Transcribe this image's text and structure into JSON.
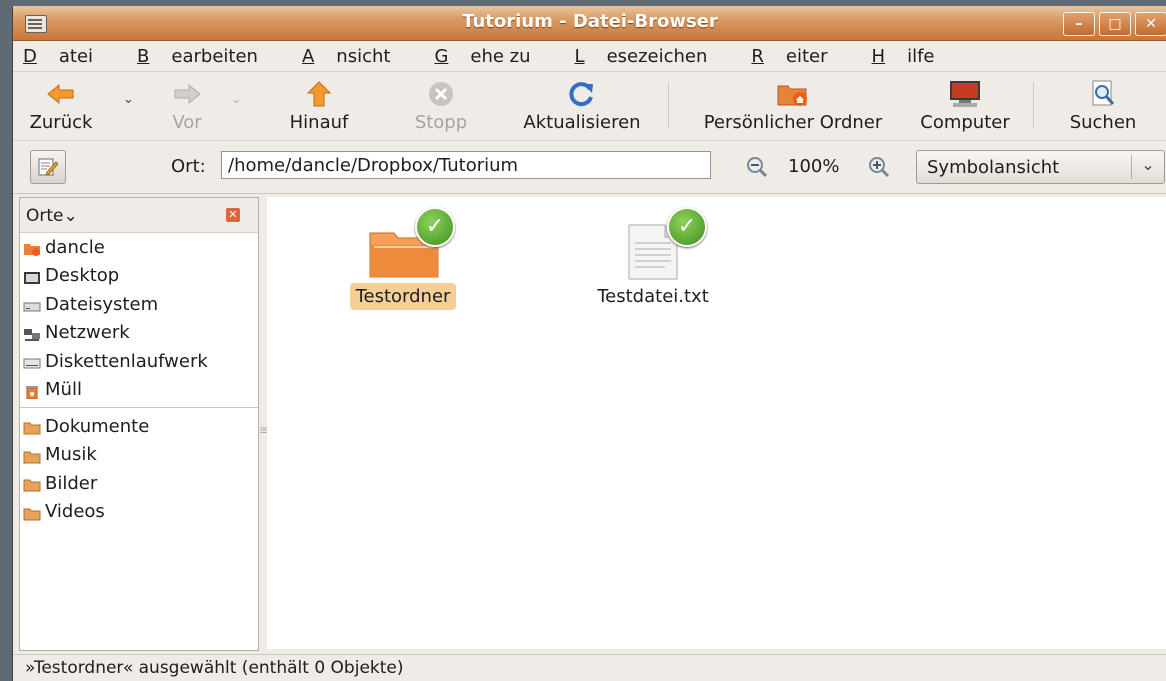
{
  "window": {
    "title": "Tutorium - Datei-Browser"
  },
  "menu": [
    {
      "label": "Datei"
    },
    {
      "label": "Bearbeiten"
    },
    {
      "label": "Ansicht"
    },
    {
      "label": "Gehe zu"
    },
    {
      "label": "Lesezeichen"
    },
    {
      "label": "Reiter"
    },
    {
      "label": "Hilfe"
    }
  ],
  "toolbar": {
    "back": "Zurück",
    "forward": "Vor",
    "up": "Hinauf",
    "stop": "Stopp",
    "reload": "Aktualisieren",
    "home": "Persönlicher Ordner",
    "computer": "Computer",
    "search": "Suchen"
  },
  "location": {
    "label": "Ort:",
    "path": "/home/dancle/Dropbox/Tutorium",
    "zoom": "100%",
    "view": "Symbolansicht"
  },
  "sidebar": {
    "header": "Orte",
    "places": [
      {
        "label": "dancle",
        "icon": "home-folder-icon"
      },
      {
        "label": "Desktop",
        "icon": "desktop-icon"
      },
      {
        "label": "Dateisystem",
        "icon": "filesystem-icon"
      },
      {
        "label": "Netzwerk",
        "icon": "network-icon"
      },
      {
        "label": "Diskettenlaufwerk",
        "icon": "floppy-drive-icon"
      },
      {
        "label": "Müll",
        "icon": "trash-icon"
      }
    ],
    "bookmarks": [
      {
        "label": "Dokumente",
        "icon": "folder-icon"
      },
      {
        "label": "Musik",
        "icon": "folder-icon"
      },
      {
        "label": "Bilder",
        "icon": "folder-icon"
      },
      {
        "label": "Videos",
        "icon": "folder-icon"
      }
    ]
  },
  "files": [
    {
      "name": "Testordner",
      "type": "folder",
      "synced": true,
      "selected": true
    },
    {
      "name": "Testdatei.txt",
      "type": "text-file",
      "synced": true,
      "selected": false
    }
  ],
  "status": "»Testordner« ausgewählt (enthält 0 Objekte)",
  "colors": {
    "accent": "#d98c4a",
    "selection": "#f6cf95",
    "sync_ok": "#4a9d24"
  }
}
